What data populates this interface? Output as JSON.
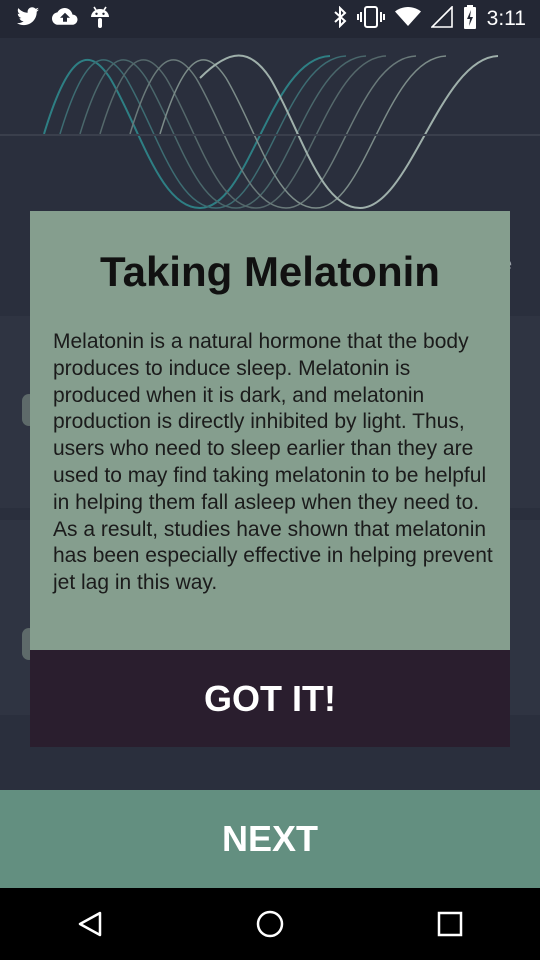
{
  "status_bar": {
    "time": "3:11",
    "left_icons": [
      "twitter-icon",
      "cloud-upload-icon",
      "android-icon"
    ],
    "right_icons": [
      "bluetooth-icon",
      "vibrate-icon",
      "wifi-icon",
      "no-signal-icon",
      "battery-charging-icon"
    ]
  },
  "background": {
    "partial_text": "e"
  },
  "dialog": {
    "title": "Taking Melatonin",
    "body": "Melatonin is a natural hormone that the body produces to induce sleep. Melatonin is produced when it is dark, and melatonin production is directly inhibited by light. Thus, users who need to sleep earlier than they are used to may find taking melatonin to be helpful in helping them fall asleep when they need to. As a result, studies have shown that melatonin has been especially effective in helping prevent jet lag in this way.",
    "confirm_label": "GOT IT!"
  },
  "footer": {
    "next_label": "NEXT"
  },
  "nav_bar": {
    "buttons": [
      "back-icon",
      "home-icon",
      "recents-icon"
    ]
  },
  "colors": {
    "background": "#2a2f3d",
    "dialog": "#859e8e",
    "confirm_button": "#2a1e2e",
    "next_button": "#638f80",
    "wave_teal": "#2e7f84",
    "wave_light": "#9fb0ab"
  }
}
